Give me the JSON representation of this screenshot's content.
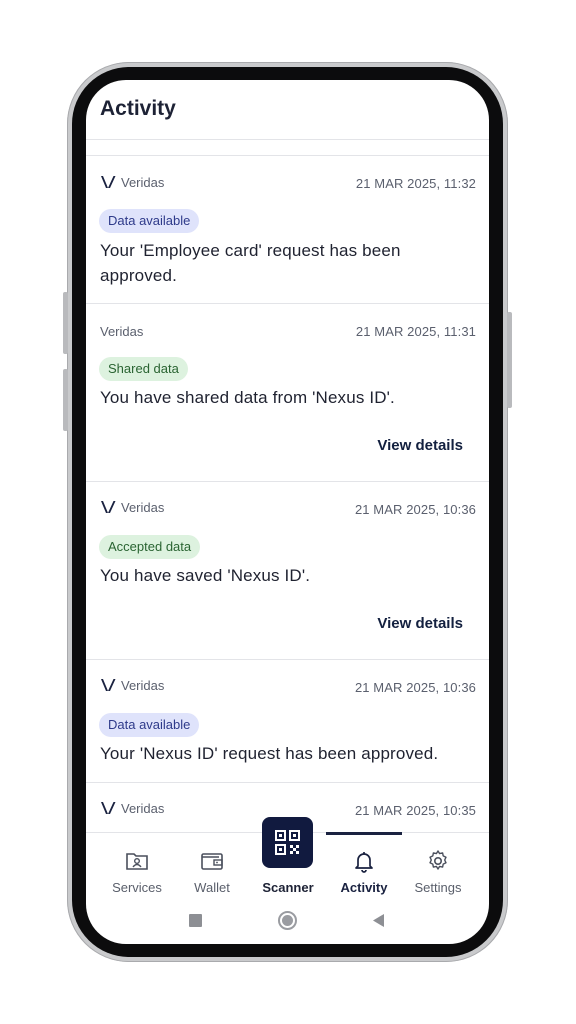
{
  "header": {
    "title": "Activity"
  },
  "cards": [
    {
      "issuer": "Veridas",
      "timestamp": "21 MAR 2025, 11:32",
      "badge": "Data available",
      "badge_color": "#dfe3fb",
      "message_line1": "Your 'Employee card' request has been",
      "message_line2": "approved.",
      "show_logo": true
    },
    {
      "issuer": "Veridas",
      "timestamp": "21 MAR 2025, 11:31",
      "badge": "Shared data",
      "badge_color": "#ddf2df",
      "message": "You have shared data from 'Nexus ID'.",
      "action": "View details",
      "show_logo": false
    },
    {
      "issuer": "Veridas",
      "timestamp": "21 MAR 2025, 10:36",
      "badge": "Accepted data",
      "badge_color": "#ddf2df",
      "message": "You have saved 'Nexus ID'.",
      "action": "View details",
      "show_logo": true
    },
    {
      "issuer": "Veridas",
      "timestamp": "21 MAR 2025, 10:36",
      "badge": "Data available",
      "badge_color": "#dfe3fb",
      "message": "Your 'Nexus ID' request has been approved.",
      "show_logo": true
    },
    {
      "issuer": "Veridas",
      "timestamp": "21 MAR 2025, 10:35",
      "show_logo": true
    }
  ],
  "bottom_nav": {
    "items": [
      {
        "label": "Services",
        "icon": "services-folder-icon"
      },
      {
        "label": "Wallet",
        "icon": "wallet-icon"
      },
      {
        "label": "Scanner",
        "icon": "qr-code-icon"
      },
      {
        "label": "Activity",
        "icon": "bell-icon",
        "active": true
      },
      {
        "label": "Settings",
        "icon": "gear-icon"
      }
    ]
  },
  "colors": {
    "brand_navy": "#111a3f",
    "badge_blue": "#dfe3fb",
    "badge_green": "#ddf2df"
  }
}
